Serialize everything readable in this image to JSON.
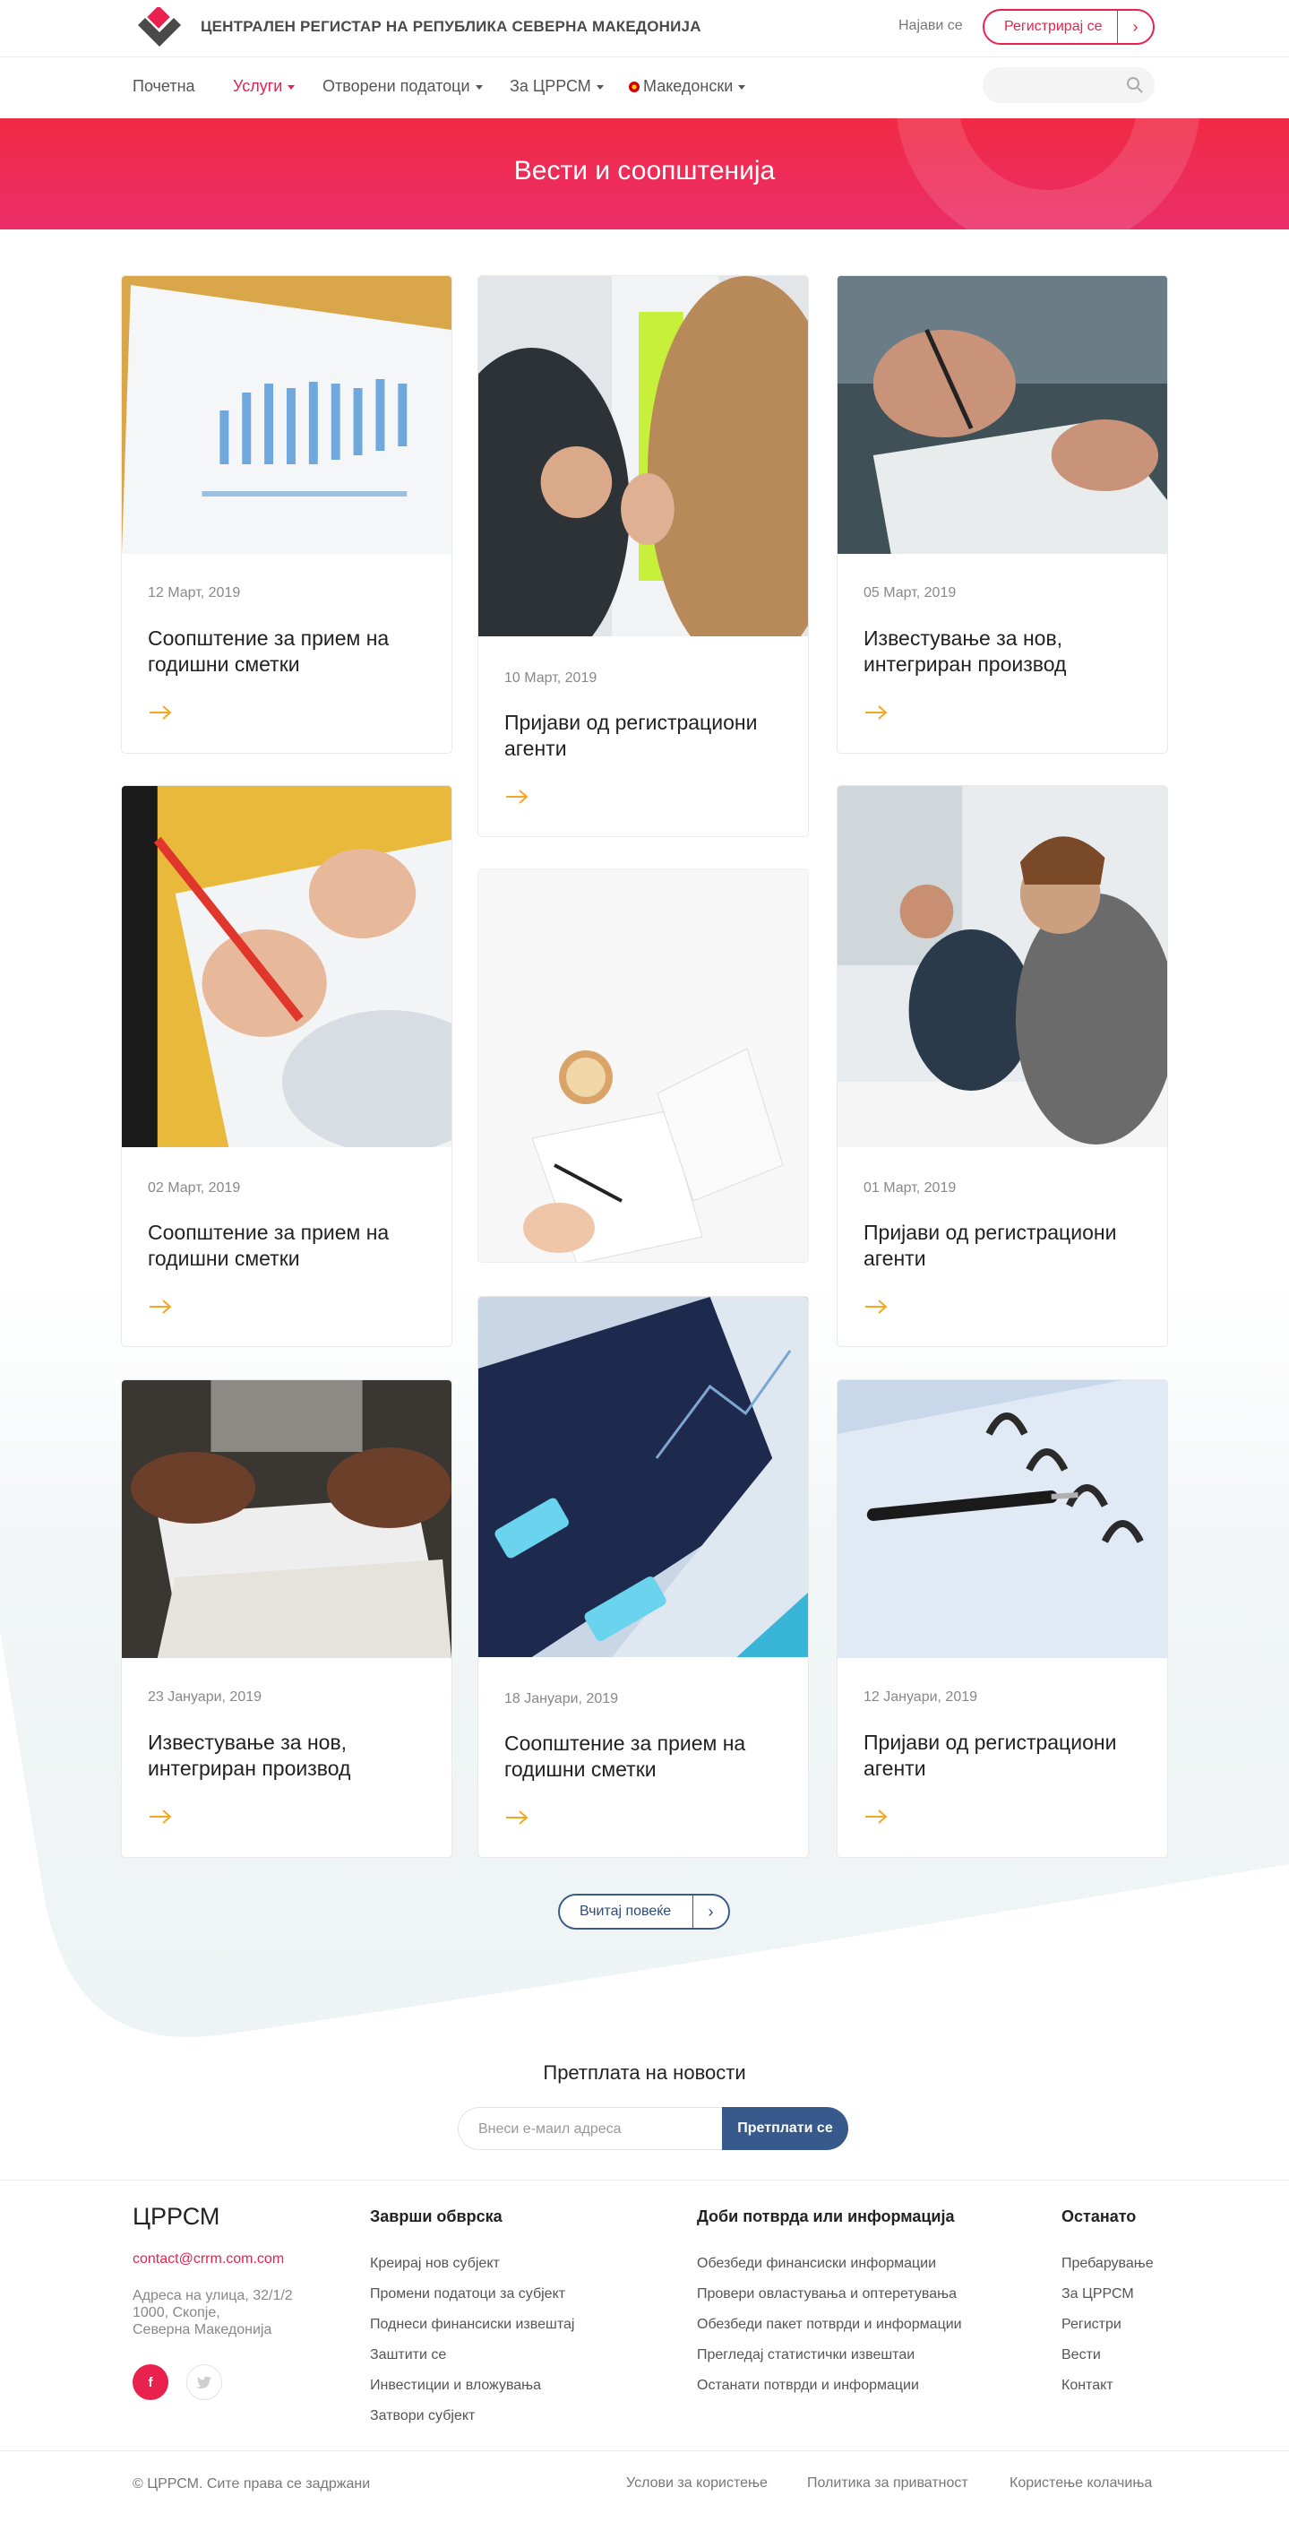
{
  "header": {
    "title": "ЦЕНТРАЛЕН РЕГИСТАР НА РЕПУБЛИКА СЕВЕРНА МАКЕДОНИЈА",
    "login": "Најави се",
    "register": "Регистрирај се"
  },
  "nav": {
    "items": [
      {
        "label": "Почетна"
      },
      {
        "label": "Услуги"
      },
      {
        "label": "Отворени податоци"
      },
      {
        "label": "За ЦРРСМ"
      },
      {
        "label": "Македонски"
      }
    ]
  },
  "hero": {
    "title": "Вести и соопштенија"
  },
  "cards": [
    {
      "date": "12 Март, 2019",
      "title": "Соопштение за  прием на годишни сметки"
    },
    {
      "date": "10 Март, 2019",
      "title": "Пријави од регистрациони агенти"
    },
    {
      "date": "05 Март, 2019",
      "title": "Известување за нов, интегриран производ"
    },
    {
      "date": "02 Март, 2019",
      "title": "Соопштение за  прием на годишни сметки"
    },
    {
      "date": "01 Март, 2019",
      "title": "Пријави од регистрациони агенти"
    },
    {
      "date": "23 Јануари, 2019",
      "title": "Известување за нов, интегриран производ"
    },
    {
      "date": "18 Јануари, 2019",
      "title": "Соопштение за  прием на годишни сметки"
    },
    {
      "date": "12 Јануари, 2019",
      "title": "Пријави од регистрациони агенти"
    }
  ],
  "load_more": "Вчитај повеќе",
  "newsletter": {
    "title": "Претплата на новости",
    "placeholder": "Внеси е-маил адреса",
    "button": "Претплати се"
  },
  "footer": {
    "brand": "ЦРРСМ",
    "email": "contact@crrm.com.com",
    "address": [
      "Адреса на улица, 32/1/2",
      "1000, Скопје,",
      "Северна Македонија"
    ],
    "columns": [
      {
        "title": "Заврши обврска",
        "links": [
          "Креирај нов субјект",
          "Промени податоци за субјект",
          "Поднеси финансиски извештај",
          "Заштити се",
          "Инвестиции и вложувања",
          "Затвори субјект"
        ]
      },
      {
        "title": "Доби потврда или информација",
        "links": [
          "Обезбеди финансиски информации",
          "Провери овластувања и оптеретувања",
          "Обезбеди пакет потврди и информации",
          "Прегледај статистички извештаи",
          "Останати потврди и информации"
        ]
      },
      {
        "title": "Останато",
        "links": [
          "Пребарување",
          "За ЦРРСМ",
          "Регистри",
          "Вести",
          "Контакт"
        ]
      }
    ],
    "copyright": "© ЦРРСМ. Сите права се задржани",
    "legal": [
      "Услови за користење",
      "Политика за приватност",
      "Користење колачиња"
    ]
  },
  "colors": {
    "accent": "#e8224d",
    "navy": "#37598b",
    "arrow": "#f5a623"
  }
}
